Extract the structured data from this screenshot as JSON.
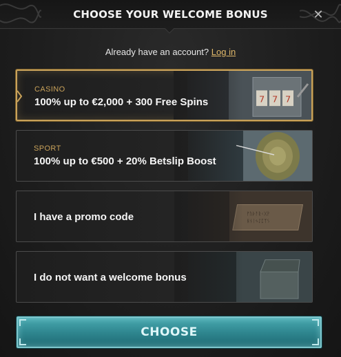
{
  "header": {
    "title": "CHOOSE YOUR WELCOME BONUS",
    "close_icon": "close-icon"
  },
  "account": {
    "prompt": "Already have an account?",
    "login_link": "Log in"
  },
  "options": [
    {
      "category": "CASINO",
      "label": "100% up to €2,000 + 300 Free Spins",
      "selected": true,
      "art": "slot-machine"
    },
    {
      "category": "SPORT",
      "label": "100% up to €500 + 20% Betslip Boost",
      "selected": false,
      "art": "archery-target"
    },
    {
      "category": "",
      "label": "I have a promo code",
      "selected": false,
      "art": "rune-tablet"
    },
    {
      "category": "",
      "label": "I do not want a welcome bonus",
      "selected": false,
      "art": "treasure-chest"
    }
  ],
  "footer": {
    "choose_label": "CHOOSE"
  },
  "colors": {
    "gold_accent": "#c9a25a",
    "link": "#e1b96a",
    "button_teal": "#2f8790"
  }
}
